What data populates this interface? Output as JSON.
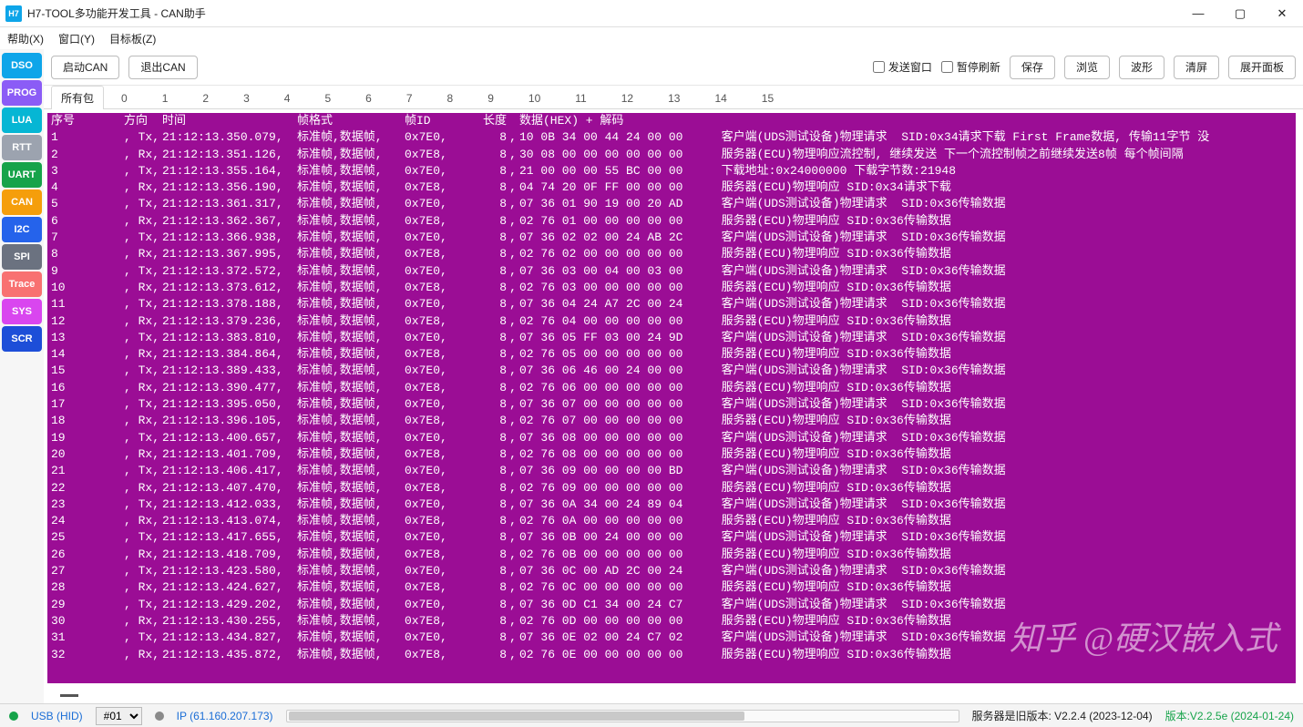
{
  "title": "H7-TOOL多功能开发工具 - CAN助手",
  "menu": [
    "帮助(X)",
    "窗口(Y)",
    "目标板(Z)"
  ],
  "sidebar": [
    {
      "label": "DSO",
      "bg": "#0ea5e9"
    },
    {
      "label": "PROG",
      "bg": "#8b5cf6"
    },
    {
      "label": "LUA",
      "bg": "#06b6d4"
    },
    {
      "label": "RTT",
      "bg": "#9ca3af"
    },
    {
      "label": "UART",
      "bg": "#16a34a"
    },
    {
      "label": "CAN",
      "bg": "#f59e0b"
    },
    {
      "label": "I2C",
      "bg": "#2563eb"
    },
    {
      "label": "SPI",
      "bg": "#6b7280"
    },
    {
      "label": "Trace",
      "bg": "#f87171"
    },
    {
      "label": "SYS",
      "bg": "#d946ef"
    },
    {
      "label": "SCR",
      "bg": "#1d4ed8"
    }
  ],
  "toolbar": {
    "start": "启动CAN",
    "stop": "退出CAN",
    "chk_send": "发送窗口",
    "chk_pause": "暂停刷新",
    "btns": [
      "保存",
      "浏览",
      "波形",
      "清屏",
      "展开面板"
    ]
  },
  "tabs": {
    "all": "所有包",
    "nums": [
      "0",
      "1",
      "2",
      "3",
      "4",
      "5",
      "6",
      "7",
      "8",
      "9",
      "10",
      "11",
      "12",
      "13",
      "14",
      "15"
    ]
  },
  "headers": {
    "seq": "序号",
    "dir": "方向",
    "time": "时间",
    "fmt": "帧格式",
    "id": "帧ID",
    "len": "长度",
    "hex": "数据(HEX) + 解码"
  },
  "rows": [
    {
      "n": "1",
      "d": "Tx",
      "t": "21:12:13.350.079",
      "f": "标准帧,数据帧",
      "id": "0x7E0",
      "l": "8",
      "h": "10 0B 34 00 44 24 00 00",
      "c": "客户端(UDS测试设备)物理请求  SID:0x34请求下载 First Frame数据, 传输11字节 没"
    },
    {
      "n": "2",
      "d": "Rx",
      "t": "21:12:13.351.126",
      "f": "标准帧,数据帧",
      "id": "0x7E8",
      "l": "8",
      "h": "30 08 00 00 00 00 00 00",
      "c": "服务器(ECU)物理响应流控制, 继续发送 下一个流控制帧之前继续发送8帧 每个帧间隔"
    },
    {
      "n": "3",
      "d": "Tx",
      "t": "21:12:13.355.164",
      "f": "标准帧,数据帧",
      "id": "0x7E0",
      "l": "8",
      "h": "21 00 00 00 55 BC 00 00",
      "c": "下载地址:0x24000000 下载字节数:21948"
    },
    {
      "n": "4",
      "d": "Rx",
      "t": "21:12:13.356.190",
      "f": "标准帧,数据帧",
      "id": "0x7E8",
      "l": "8",
      "h": "04 74 20 0F FF 00 00 00",
      "c": "服务器(ECU)物理响应 SID:0x34请求下载"
    },
    {
      "n": "5",
      "d": "Tx",
      "t": "21:12:13.361.317",
      "f": "标准帧,数据帧",
      "id": "0x7E0",
      "l": "8",
      "h": "07 36 01 90 19 00 20 AD",
      "c": "客户端(UDS测试设备)物理请求  SID:0x36传输数据"
    },
    {
      "n": "6",
      "d": "Rx",
      "t": "21:12:13.362.367",
      "f": "标准帧,数据帧",
      "id": "0x7E8",
      "l": "8",
      "h": "02 76 01 00 00 00 00 00",
      "c": "服务器(ECU)物理响应 SID:0x36传输数据"
    },
    {
      "n": "7",
      "d": "Tx",
      "t": "21:12:13.366.938",
      "f": "标准帧,数据帧",
      "id": "0x7E0",
      "l": "8",
      "h": "07 36 02 02 00 24 AB 2C",
      "c": "客户端(UDS测试设备)物理请求  SID:0x36传输数据"
    },
    {
      "n": "8",
      "d": "Rx",
      "t": "21:12:13.367.995",
      "f": "标准帧,数据帧",
      "id": "0x7E8",
      "l": "8",
      "h": "02 76 02 00 00 00 00 00",
      "c": "服务器(ECU)物理响应 SID:0x36传输数据"
    },
    {
      "n": "9",
      "d": "Tx",
      "t": "21:12:13.372.572",
      "f": "标准帧,数据帧",
      "id": "0x7E0",
      "l": "8",
      "h": "07 36 03 00 04 00 03 00",
      "c": "客户端(UDS测试设备)物理请求  SID:0x36传输数据"
    },
    {
      "n": "10",
      "d": "Rx",
      "t": "21:12:13.373.612",
      "f": "标准帧,数据帧",
      "id": "0x7E8",
      "l": "8",
      "h": "02 76 03 00 00 00 00 00",
      "c": "服务器(ECU)物理响应 SID:0x36传输数据"
    },
    {
      "n": "11",
      "d": "Tx",
      "t": "21:12:13.378.188",
      "f": "标准帧,数据帧",
      "id": "0x7E0",
      "l": "8",
      "h": "07 36 04 24 A7 2C 00 24",
      "c": "客户端(UDS测试设备)物理请求  SID:0x36传输数据"
    },
    {
      "n": "12",
      "d": "Rx",
      "t": "21:12:13.379.236",
      "f": "标准帧,数据帧",
      "id": "0x7E8",
      "l": "8",
      "h": "02 76 04 00 00 00 00 00",
      "c": "服务器(ECU)物理响应 SID:0x36传输数据"
    },
    {
      "n": "13",
      "d": "Tx",
      "t": "21:12:13.383.810",
      "f": "标准帧,数据帧",
      "id": "0x7E0",
      "l": "8",
      "h": "07 36 05 FF 03 00 24 9D",
      "c": "客户端(UDS测试设备)物理请求  SID:0x36传输数据"
    },
    {
      "n": "14",
      "d": "Rx",
      "t": "21:12:13.384.864",
      "f": "标准帧,数据帧",
      "id": "0x7E8",
      "l": "8",
      "h": "02 76 05 00 00 00 00 00",
      "c": "服务器(ECU)物理响应 SID:0x36传输数据"
    },
    {
      "n": "15",
      "d": "Tx",
      "t": "21:12:13.389.433",
      "f": "标准帧,数据帧",
      "id": "0x7E0",
      "l": "8",
      "h": "07 36 06 46 00 24 00 00",
      "c": "客户端(UDS测试设备)物理请求  SID:0x36传输数据"
    },
    {
      "n": "16",
      "d": "Rx",
      "t": "21:12:13.390.477",
      "f": "标准帧,数据帧",
      "id": "0x7E8",
      "l": "8",
      "h": "02 76 06 00 00 00 00 00",
      "c": "服务器(ECU)物理响应 SID:0x36传输数据"
    },
    {
      "n": "17",
      "d": "Tx",
      "t": "21:12:13.395.050",
      "f": "标准帧,数据帧",
      "id": "0x7E0",
      "l": "8",
      "h": "07 36 07 00 00 00 00 00",
      "c": "客户端(UDS测试设备)物理请求  SID:0x36传输数据"
    },
    {
      "n": "18",
      "d": "Rx",
      "t": "21:12:13.396.105",
      "f": "标准帧,数据帧",
      "id": "0x7E8",
      "l": "8",
      "h": "02 76 07 00 00 00 00 00",
      "c": "服务器(ECU)物理响应 SID:0x36传输数据"
    },
    {
      "n": "19",
      "d": "Tx",
      "t": "21:12:13.400.657",
      "f": "标准帧,数据帧",
      "id": "0x7E0",
      "l": "8",
      "h": "07 36 08 00 00 00 00 00",
      "c": "客户端(UDS测试设备)物理请求  SID:0x36传输数据"
    },
    {
      "n": "20",
      "d": "Rx",
      "t": "21:12:13.401.709",
      "f": "标准帧,数据帧",
      "id": "0x7E8",
      "l": "8",
      "h": "02 76 08 00 00 00 00 00",
      "c": "服务器(ECU)物理响应 SID:0x36传输数据"
    },
    {
      "n": "21",
      "d": "Tx",
      "t": "21:12:13.406.417",
      "f": "标准帧,数据帧",
      "id": "0x7E0",
      "l": "8",
      "h": "07 36 09 00 00 00 00 BD",
      "c": "客户端(UDS测试设备)物理请求  SID:0x36传输数据"
    },
    {
      "n": "22",
      "d": "Rx",
      "t": "21:12:13.407.470",
      "f": "标准帧,数据帧",
      "id": "0x7E8",
      "l": "8",
      "h": "02 76 09 00 00 00 00 00",
      "c": "服务器(ECU)物理响应 SID:0x36传输数据"
    },
    {
      "n": "23",
      "d": "Tx",
      "t": "21:12:13.412.033",
      "f": "标准帧,数据帧",
      "id": "0x7E0",
      "l": "8",
      "h": "07 36 0A 34 00 24 89 04",
      "c": "客户端(UDS测试设备)物理请求  SID:0x36传输数据"
    },
    {
      "n": "24",
      "d": "Rx",
      "t": "21:12:13.413.074",
      "f": "标准帧,数据帧",
      "id": "0x7E8",
      "l": "8",
      "h": "02 76 0A 00 00 00 00 00",
      "c": "服务器(ECU)物理响应 SID:0x36传输数据"
    },
    {
      "n": "25",
      "d": "Tx",
      "t": "21:12:13.417.655",
      "f": "标准帧,数据帧",
      "id": "0x7E0",
      "l": "8",
      "h": "07 36 0B 00 24 00 00 00",
      "c": "客户端(UDS测试设备)物理请求  SID:0x36传输数据"
    },
    {
      "n": "26",
      "d": "Rx",
      "t": "21:12:13.418.709",
      "f": "标准帧,数据帧",
      "id": "0x7E8",
      "l": "8",
      "h": "02 76 0B 00 00 00 00 00",
      "c": "服务器(ECU)物理响应 SID:0x36传输数据"
    },
    {
      "n": "27",
      "d": "Tx",
      "t": "21:12:13.423.580",
      "f": "标准帧,数据帧",
      "id": "0x7E0",
      "l": "8",
      "h": "07 36 0C 00 AD 2C 00 24",
      "c": "客户端(UDS测试设备)物理请求  SID:0x36传输数据"
    },
    {
      "n": "28",
      "d": "Rx",
      "t": "21:12:13.424.627",
      "f": "标准帧,数据帧",
      "id": "0x7E8",
      "l": "8",
      "h": "02 76 0C 00 00 00 00 00",
      "c": "服务器(ECU)物理响应 SID:0x36传输数据"
    },
    {
      "n": "29",
      "d": "Tx",
      "t": "21:12:13.429.202",
      "f": "标准帧,数据帧",
      "id": "0x7E0",
      "l": "8",
      "h": "07 36 0D C1 34 00 24 C7",
      "c": "客户端(UDS测试设备)物理请求  SID:0x36传输数据"
    },
    {
      "n": "30",
      "d": "Rx",
      "t": "21:12:13.430.255",
      "f": "标准帧,数据帧",
      "id": "0x7E8",
      "l": "8",
      "h": "02 76 0D 00 00 00 00 00",
      "c": "服务器(ECU)物理响应 SID:0x36传输数据"
    },
    {
      "n": "31",
      "d": "Tx",
      "t": "21:12:13.434.827",
      "f": "标准帧,数据帧",
      "id": "0x7E0",
      "l": "8",
      "h": "07 36 0E 02 00 24 C7 02",
      "c": "客户端(UDS测试设备)物理请求  SID:0x36传输数据"
    },
    {
      "n": "32",
      "d": "Rx",
      "t": "21:12:13.435.872",
      "f": "标准帧,数据帧",
      "id": "0x7E8",
      "l": "8",
      "h": "02 76 0E 00 00 00 00 00",
      "c": "服务器(ECU)物理响应 SID:0x36传输数据"
    }
  ],
  "status": {
    "usb": "USB (HID)",
    "port": "#01",
    "ip": "IP (61.160.207.173)",
    "server": "服务器是旧版本: V2.2.4 (2023-12-04)",
    "version": "版本:V2.2.5e (2024-01-24)"
  },
  "watermark": "知乎 @硬汉嵌入式"
}
